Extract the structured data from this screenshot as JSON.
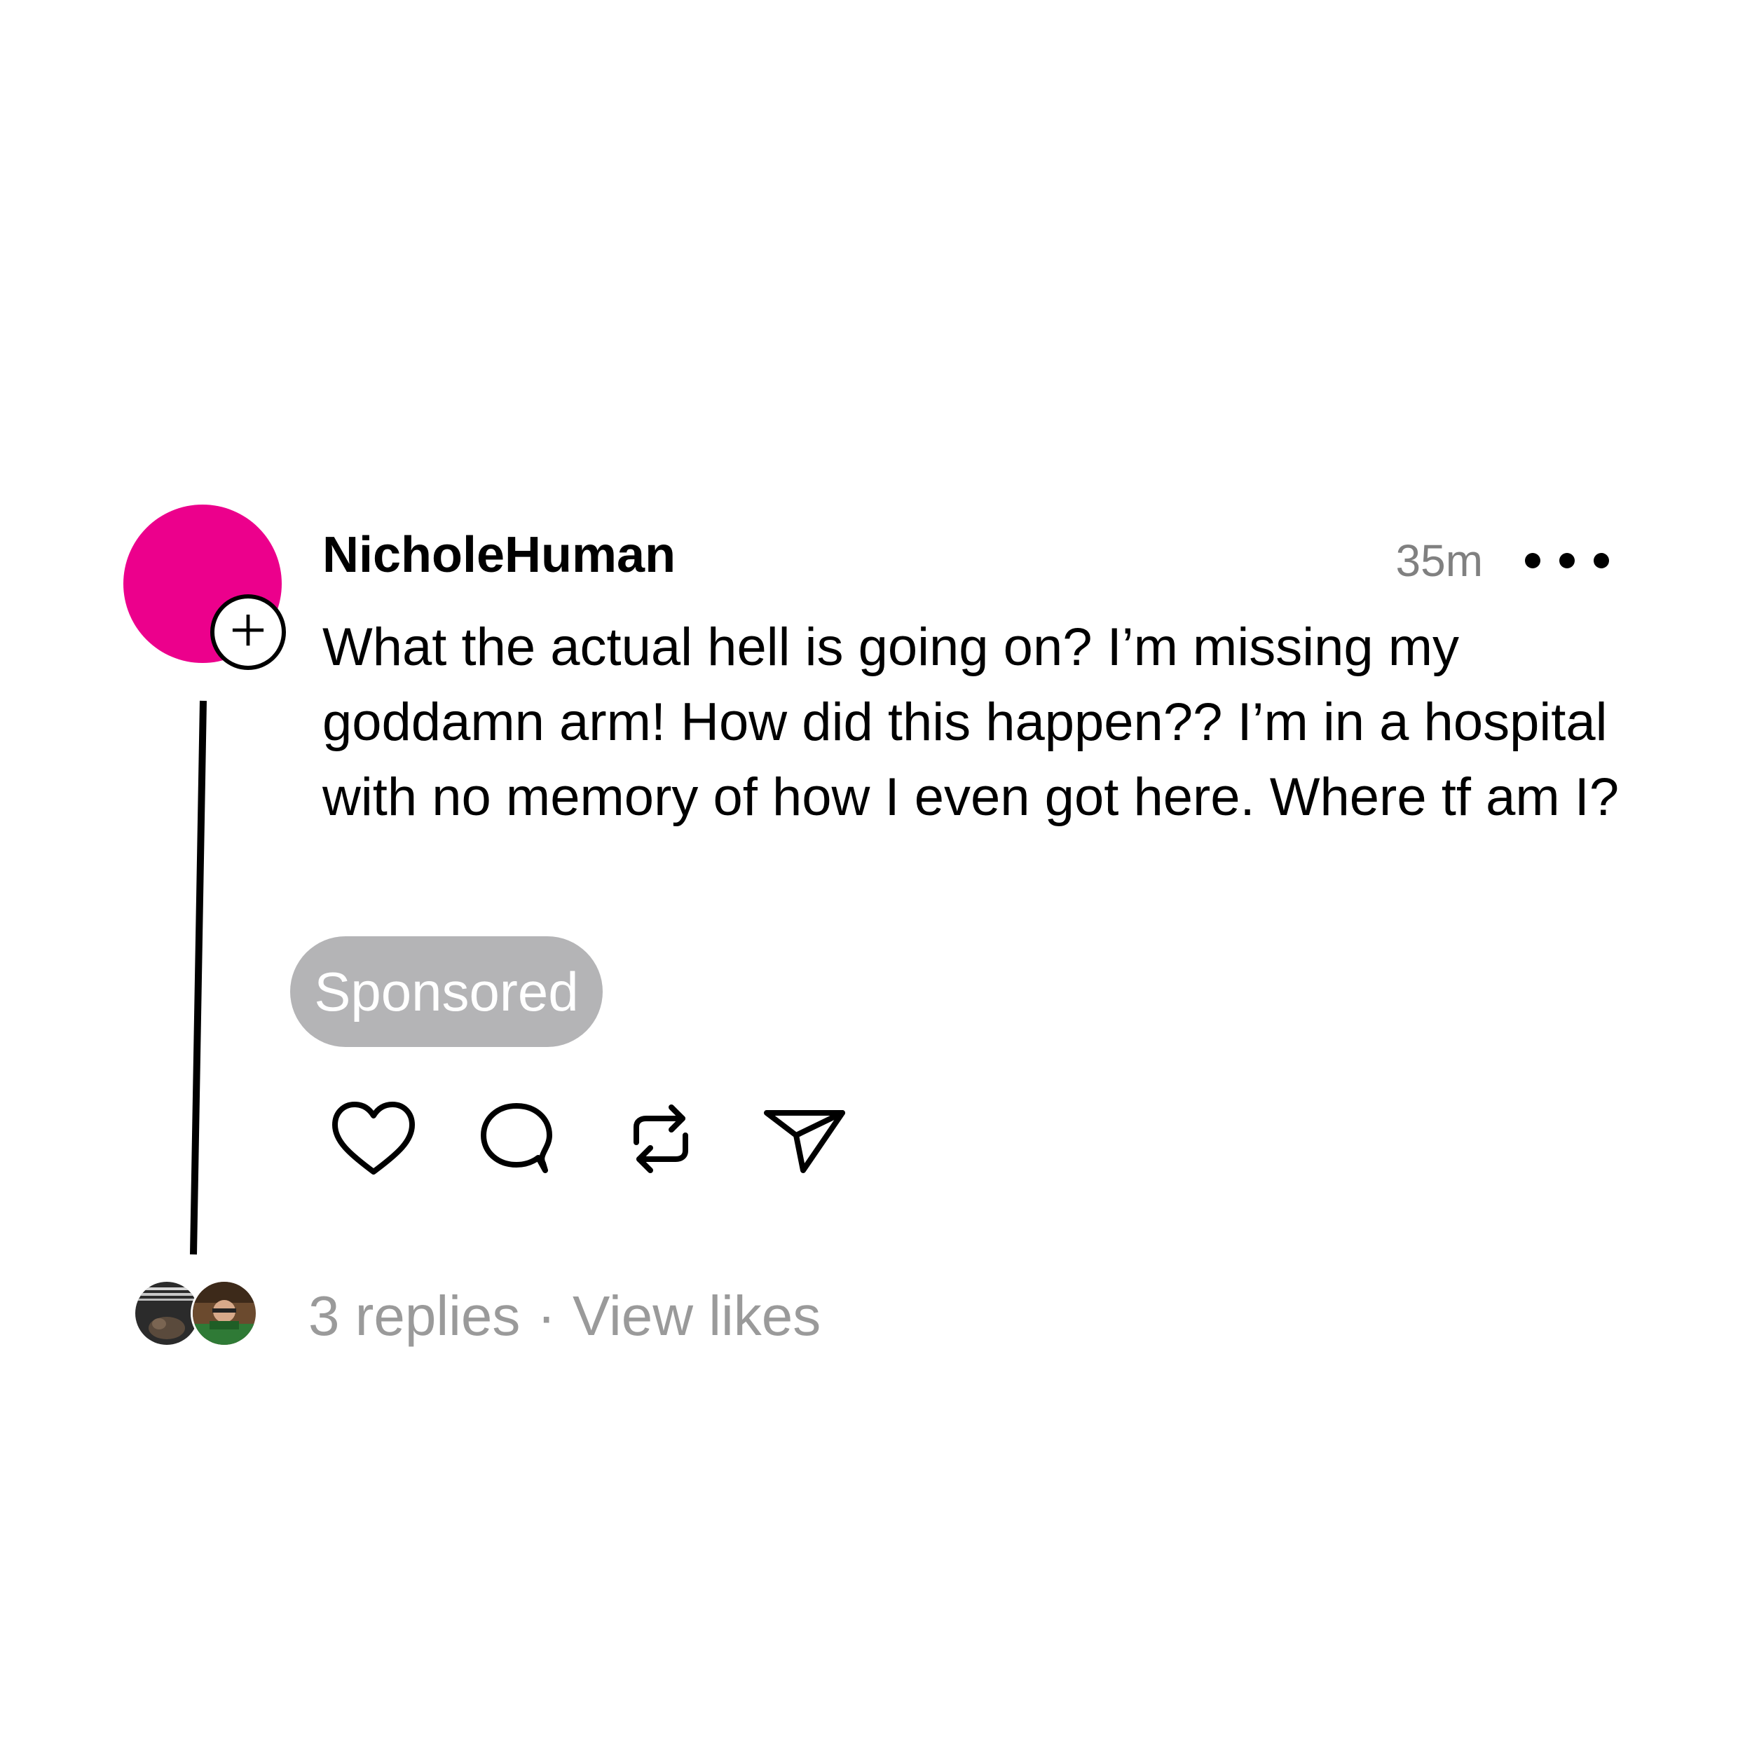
{
  "post": {
    "username": "NicholeHuman",
    "timestamp": "35m",
    "body": "What the actual hell is going on? I’m missing my goddamn arm! How did this happen?? I’m in a hospital with no memory of how I even got here. Where tf am I?",
    "sponsored_label": "Sponsored",
    "avatar_color": "#ec008c"
  },
  "icons": {
    "follow": "plus-icon",
    "more": "more-horizontal-icon",
    "like": "heart-icon",
    "comment": "comment-icon",
    "repost": "repost-icon",
    "share": "send-icon"
  },
  "footer": {
    "replies": "3 replies",
    "separator": "·",
    "view_likes": "View likes"
  }
}
